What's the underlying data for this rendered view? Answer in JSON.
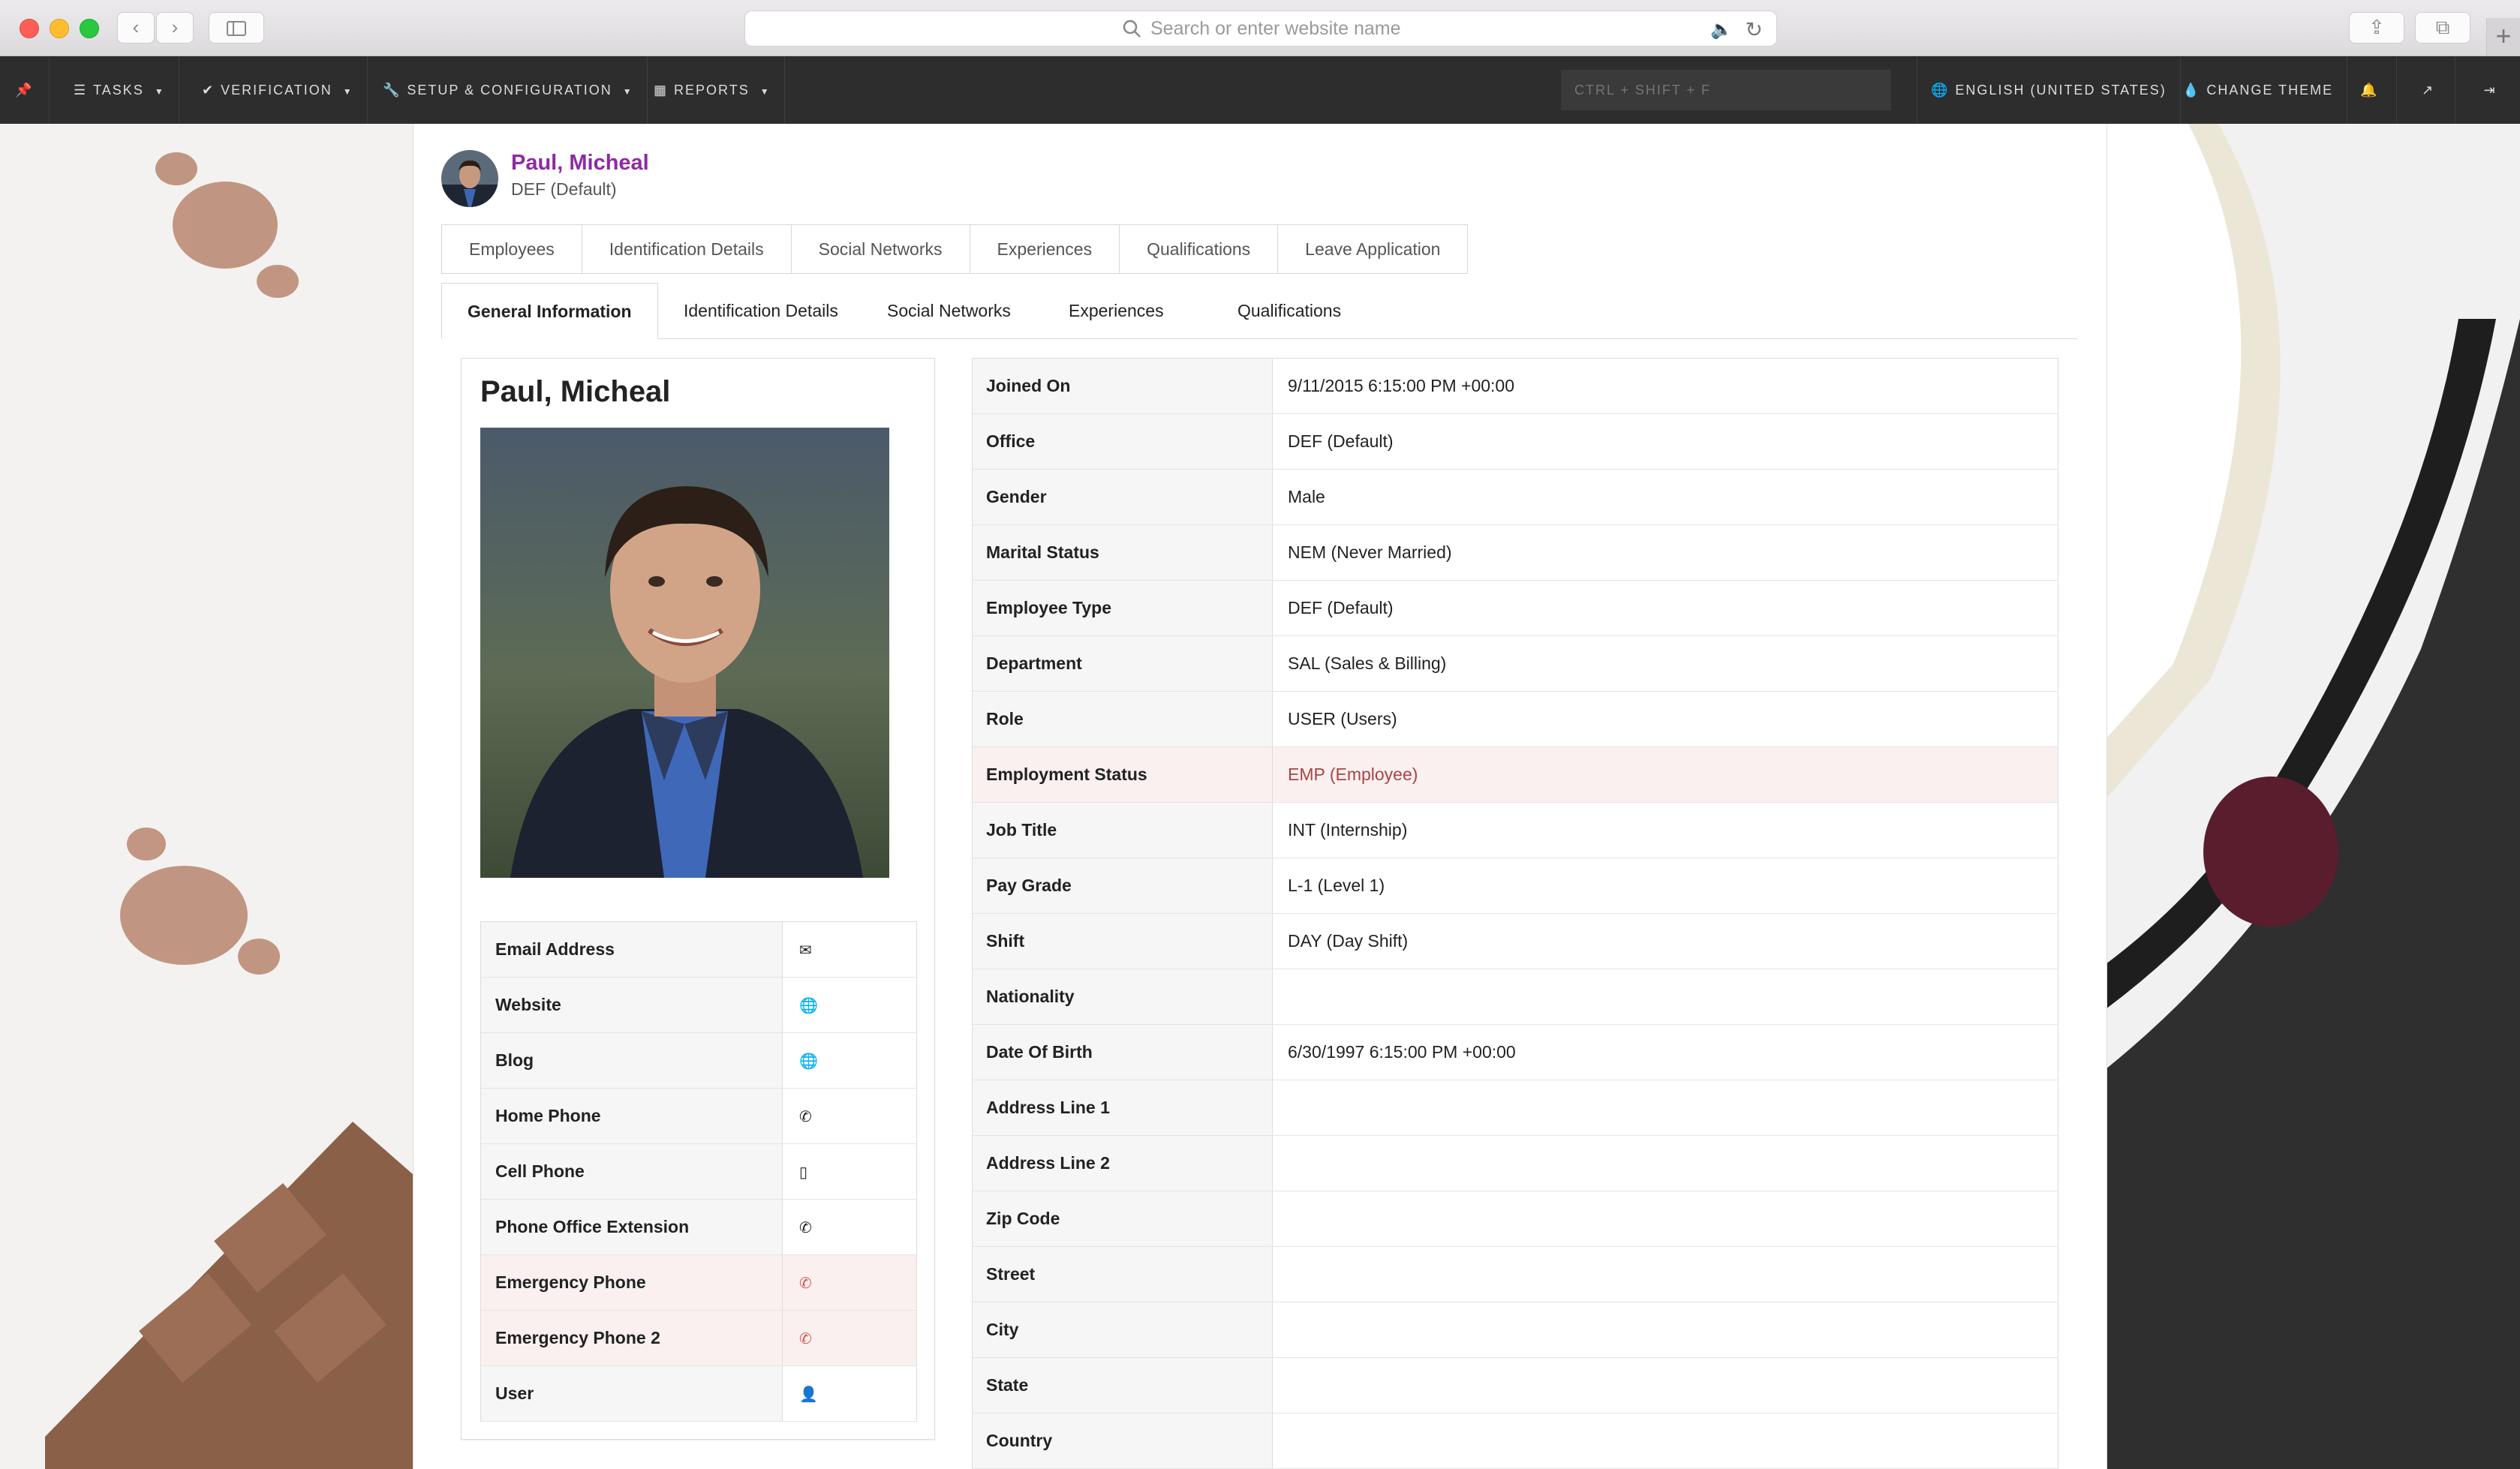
{
  "browser": {
    "address_placeholder": "Search or enter website name"
  },
  "navbar": {
    "tasks": "TASKS",
    "verification": "VERIFICATION",
    "setup": "SETUP & CONFIGURATION",
    "reports": "REPORTS",
    "search_placeholder": "CTRL + SHIFT + F",
    "language": "ENGLISH (UNITED STATES)",
    "theme": "CHANGE THEME"
  },
  "header": {
    "name": "Paul, Micheal",
    "office": "DEF (Default)"
  },
  "top_tabs": [
    "Employees",
    "Identification Details",
    "Social Networks",
    "Experiences",
    "Qualifications",
    "Leave Application"
  ],
  "sub_tabs": [
    "General Information",
    "Identification Details",
    "Social Networks",
    "Experiences",
    "Qualifications"
  ],
  "card": {
    "name": "Paul, Micheal"
  },
  "contacts": [
    {
      "label": "Email Address",
      "icon": "envelope-icon"
    },
    {
      "label": "Website",
      "icon": "globe-icon"
    },
    {
      "label": "Blog",
      "icon": "globe-icon"
    },
    {
      "label": "Home Phone",
      "icon": "phone-icon"
    },
    {
      "label": "Cell Phone",
      "icon": "mobile-icon"
    },
    {
      "label": "Phone Office Extension",
      "icon": "phone-icon"
    },
    {
      "label": "Emergency Phone",
      "icon": "phone-icon"
    },
    {
      "label": "Emergency Phone 2",
      "icon": "phone-icon"
    },
    {
      "label": "User",
      "icon": "user-icon"
    }
  ],
  "details": [
    {
      "label": "Joined On",
      "value": "9/11/2015 6:15:00 PM +00:00"
    },
    {
      "label": "Office",
      "value": "DEF (Default)"
    },
    {
      "label": "Gender",
      "value": "Male"
    },
    {
      "label": "Marital Status",
      "value": "NEM (Never Married)"
    },
    {
      "label": "Employee Type",
      "value": "DEF (Default)"
    },
    {
      "label": "Department",
      "value": "SAL (Sales & Billing)"
    },
    {
      "label": "Role",
      "value": "USER (Users)"
    },
    {
      "label": "Employment Status",
      "value": "EMP (Employee)"
    },
    {
      "label": "Job Title",
      "value": "INT (Internship)"
    },
    {
      "label": "Pay Grade",
      "value": "L-1 (Level 1)"
    },
    {
      "label": "Shift",
      "value": "DAY (Day Shift)"
    },
    {
      "label": "Nationality",
      "value": ""
    },
    {
      "label": "Date Of Birth",
      "value": "6/30/1997 6:15:00 PM +00:00"
    },
    {
      "label": "Address Line 1",
      "value": ""
    },
    {
      "label": "Address Line 2",
      "value": ""
    },
    {
      "label": "Zip Code",
      "value": ""
    },
    {
      "label": "Street",
      "value": ""
    },
    {
      "label": "City",
      "value": ""
    },
    {
      "label": "State",
      "value": ""
    },
    {
      "label": "Country",
      "value": ""
    }
  ],
  "colors": {
    "name_accent": "#8e2aa3",
    "navbar_bg": "#2d2d2d",
    "danger_row": "#fbf0f0",
    "danger_text": "#a94442",
    "emergency_icon": "#d9534f"
  }
}
